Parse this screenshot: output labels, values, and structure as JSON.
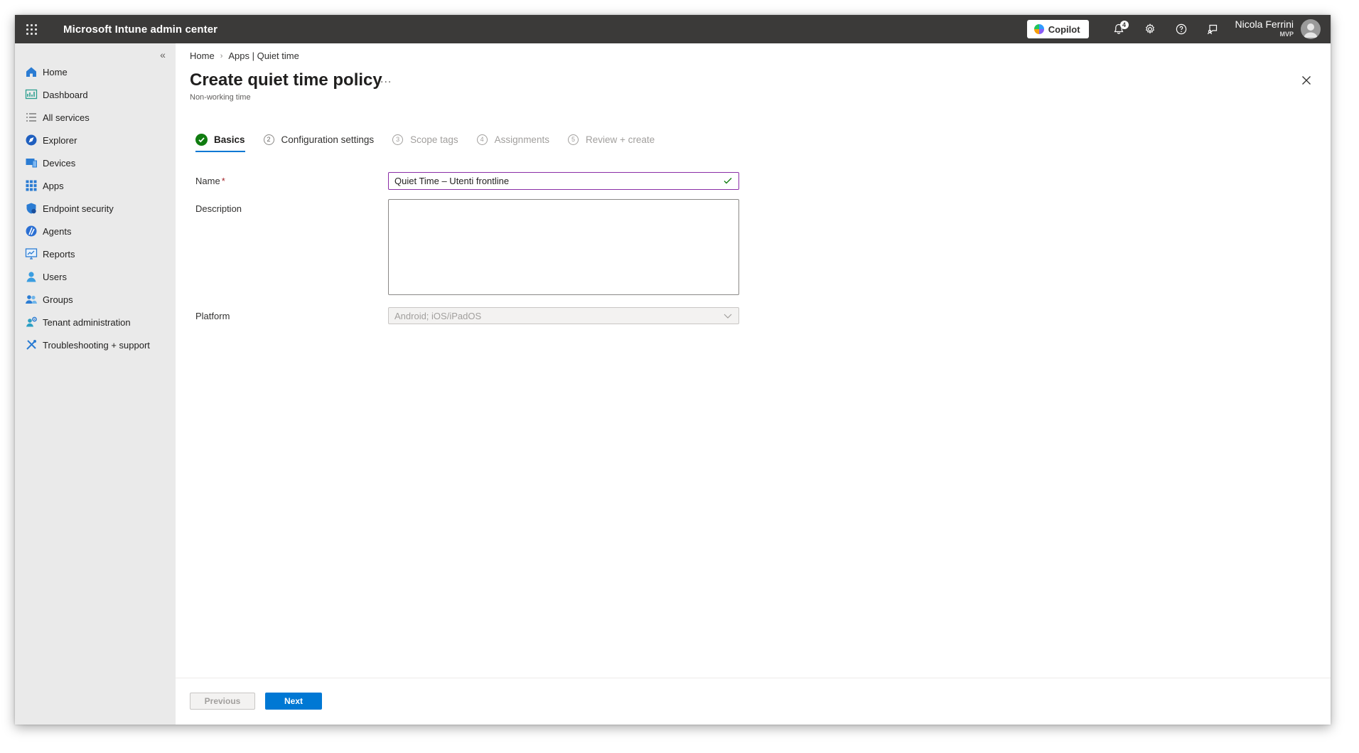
{
  "app": {
    "title": "Microsoft Intune admin center",
    "copilot_label": "Copilot",
    "notifications_count": "4",
    "user_name": "Nicola Ferrini",
    "user_tag": "MVP"
  },
  "sidebar": {
    "items": [
      {
        "label": "Home",
        "icon": "home-icon"
      },
      {
        "label": "Dashboard",
        "icon": "dashboard-icon"
      },
      {
        "label": "All services",
        "icon": "list-icon"
      },
      {
        "label": "Explorer",
        "icon": "explorer-icon"
      },
      {
        "label": "Devices",
        "icon": "devices-icon"
      },
      {
        "label": "Apps",
        "icon": "apps-grid-icon"
      },
      {
        "label": "Endpoint security",
        "icon": "shield-icon"
      },
      {
        "label": "Agents",
        "icon": "agents-icon"
      },
      {
        "label": "Reports",
        "icon": "reports-icon"
      },
      {
        "label": "Users",
        "icon": "user-icon"
      },
      {
        "label": "Groups",
        "icon": "groups-icon"
      },
      {
        "label": "Tenant administration",
        "icon": "tenant-icon"
      },
      {
        "label": "Troubleshooting + support",
        "icon": "tools-icon"
      }
    ]
  },
  "breadcrumb": {
    "home": "Home",
    "apps": "Apps | Quiet time"
  },
  "page": {
    "title": "Create quiet time policy",
    "more": "...",
    "subtitle": "Non-working time"
  },
  "steps": [
    {
      "number": "1",
      "label": "Basics",
      "state": "complete"
    },
    {
      "number": "2",
      "label": "Configuration settings",
      "state": "pending"
    },
    {
      "number": "3",
      "label": "Scope tags",
      "state": "inactive"
    },
    {
      "number": "4",
      "label": "Assignments",
      "state": "inactive"
    },
    {
      "number": "5",
      "label": "Review + create",
      "state": "inactive"
    }
  ],
  "form": {
    "name_label": "Name",
    "required_mark": "*",
    "name_value": "Quiet Time – Utenti frontline",
    "description_label": "Description",
    "description_value": "",
    "platform_label": "Platform",
    "platform_value": "Android; iOS/iPadOS"
  },
  "footer": {
    "previous_label": "Previous",
    "next_label": "Next"
  },
  "colors": {
    "topbar": "#3b3a39",
    "accent": "#0078d4",
    "success": "#107c10",
    "focus_border": "#8a2da6"
  }
}
